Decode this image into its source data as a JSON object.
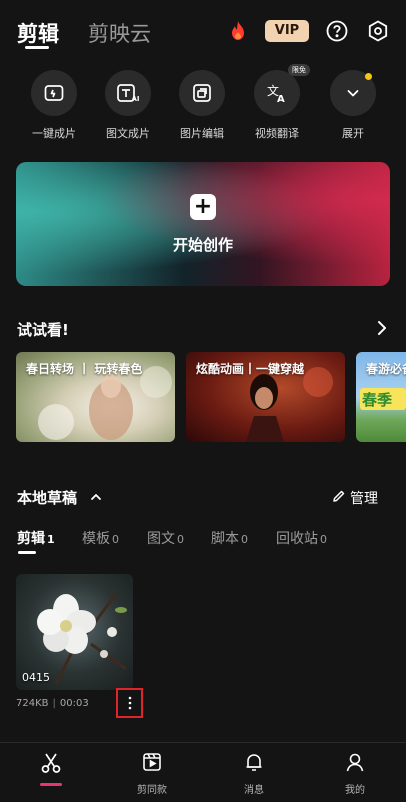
{
  "header": {
    "tab_edit": "剪辑",
    "tab_cloud": "剪映云",
    "vip_label": "VIP"
  },
  "quick_actions": [
    {
      "label": "一键成片",
      "icon": "video-magic-icon"
    },
    {
      "label": "图文成片",
      "icon": "text-ai-icon"
    },
    {
      "label": "图片编辑",
      "icon": "image-edit-icon"
    },
    {
      "label": "视频翻译",
      "icon": "translate-icon",
      "badge": "限免"
    },
    {
      "label": "展开",
      "icon": "chevron-down-icon"
    }
  ],
  "create": {
    "label": "开始创作"
  },
  "try_section": {
    "title": "试试看!",
    "cards": [
      {
        "label": "春日转场 丨 玩转春色"
      },
      {
        "label": "炫酷动画丨一键穿越"
      },
      {
        "label": "春游必备"
      }
    ]
  },
  "drafts": {
    "title": "本地草稿",
    "manage_label": "管理",
    "tabs": [
      {
        "label": "剪辑",
        "count": "1"
      },
      {
        "label": "模板",
        "count": "0"
      },
      {
        "label": "图文",
        "count": "0"
      },
      {
        "label": "脚本",
        "count": "0"
      },
      {
        "label": "回收站",
        "count": "0"
      }
    ],
    "items": [
      {
        "name": "0415",
        "size": "724KB",
        "duration": "00:03"
      }
    ]
  },
  "bottom_nav": [
    {
      "label": "",
      "icon": "scissors-icon"
    },
    {
      "label": "剪同款",
      "icon": "template-icon"
    },
    {
      "label": "消息",
      "icon": "bell-icon"
    },
    {
      "label": "我的",
      "icon": "profile-icon"
    }
  ],
  "colors": {
    "background": "#141414",
    "accent": "#e8356d",
    "vip": "#f2d3b1",
    "highlight_box": "#e0242a"
  }
}
